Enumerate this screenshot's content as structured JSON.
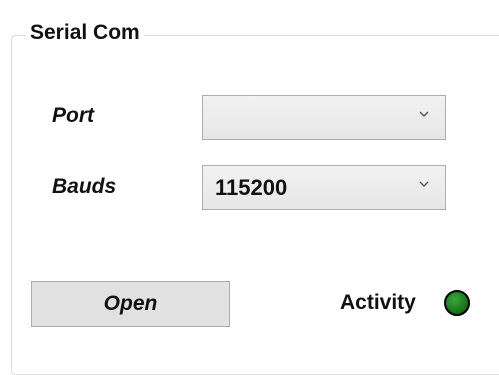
{
  "group": {
    "title": "Serial Com"
  },
  "port": {
    "label": "Port",
    "value": ""
  },
  "bauds": {
    "label": "Bauds",
    "value": "115200"
  },
  "open_button": {
    "label": "Open"
  },
  "activity": {
    "label": "Activity",
    "led_color": "#1e7a1e"
  },
  "icons": {
    "combo_arrow": "chevron-down-icon",
    "activity_led": "status-led-icon"
  }
}
